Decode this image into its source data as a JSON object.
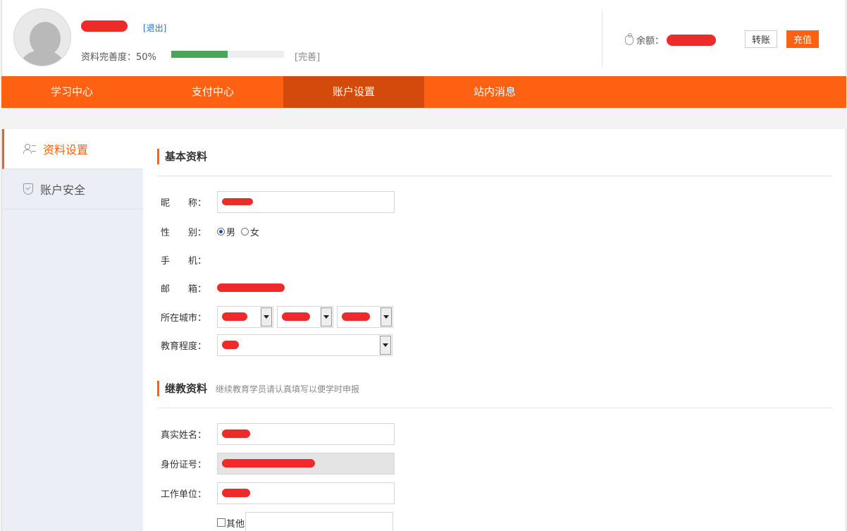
{
  "header": {
    "logout_label": "[退出]",
    "completion_label": "资料完善度：50%",
    "completion_value": 0.5,
    "perfect_label": "[完善]",
    "balance_label": "余额：",
    "transfer_label": "转账",
    "recharge_label": "充值"
  },
  "nav": {
    "items": [
      {
        "label": "学习中心"
      },
      {
        "label": "支付中心"
      },
      {
        "label": "账户设置"
      },
      {
        "label": "站内消息"
      }
    ],
    "active_index": 2
  },
  "sidebar": {
    "items": [
      {
        "label": "资料设置",
        "icon": "user-card-icon"
      },
      {
        "label": "账户安全",
        "icon": "shield-check-icon"
      }
    ]
  },
  "basic": {
    "title": "基本资料",
    "nickname_label": "昵　　称：",
    "gender_label": "性　　别：",
    "gender_options": [
      "男",
      "女"
    ],
    "gender_selected": "男",
    "phone_label": "手　　机：",
    "email_label": "邮　　箱：",
    "city_label": "所在城市：",
    "education_label": "教育程度："
  },
  "continuing": {
    "title": "继教资料",
    "note": "继续教育学员请认真填写以便学时申报",
    "realname_label": "真实姓名：",
    "idcard_label": "身份证号：",
    "workplace_label": "工作单位：",
    "other_label": "其他"
  },
  "colors": {
    "accent": "#ff6113",
    "nav_active": "#d44a0d",
    "progress": "#4aa55a",
    "redaction": "#ee2b2b"
  }
}
